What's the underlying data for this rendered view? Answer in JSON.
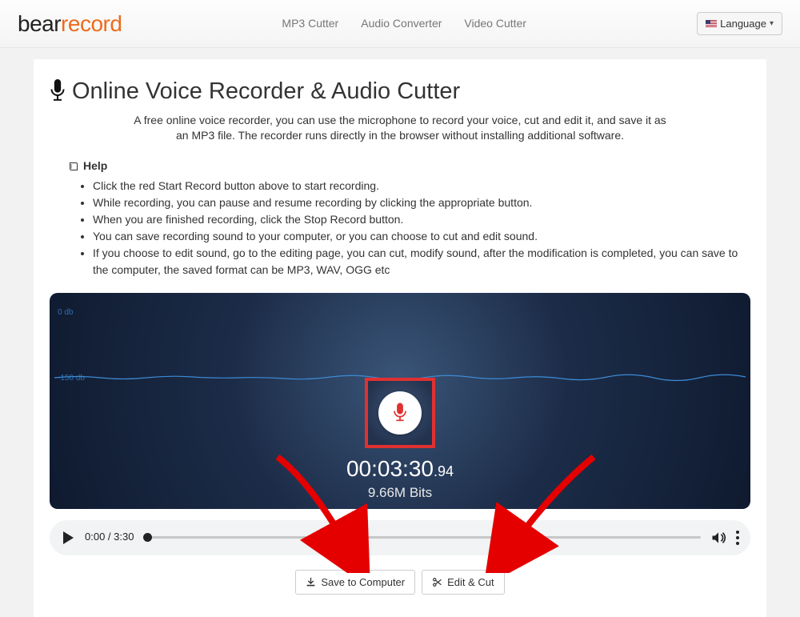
{
  "brand": {
    "part1": "bear",
    "part2": "record"
  },
  "nav": {
    "links": [
      "MP3 Cutter",
      "Audio Converter",
      "Video Cutter"
    ],
    "language_label": "Language"
  },
  "page": {
    "title": "Online Voice Recorder & Audio Cutter",
    "description": "A free online voice recorder, you can use the microphone to record your voice, cut and edit it, and save it as an MP3 file. The recorder runs directly in the browser without installing additional software."
  },
  "help": {
    "heading": "Help",
    "items": [
      "Click the red Start Record button above to start recording.",
      "While recording, you can pause and resume recording by clicking the appropriate button.",
      "When you are finished recording, click the Stop Record button.",
      "You can save recording sound to your computer, or you can choose to cut and edit sound.",
      "If you choose to edit sound, go to the editing page, you can cut, modify sound, after the modification is completed, you can save to the computer, the saved format can be MP3, WAV, OGG etc"
    ]
  },
  "recorder": {
    "db_top": "0 db",
    "db_mid": "-150 db",
    "timer_main": "00:03:30",
    "timer_ms": ".94",
    "bits": "9.66M Bits"
  },
  "player": {
    "current": "0:00",
    "separator": " / ",
    "duration": "3:30"
  },
  "buttons": {
    "save": "Save to Computer",
    "edit": "Edit & Cut"
  }
}
